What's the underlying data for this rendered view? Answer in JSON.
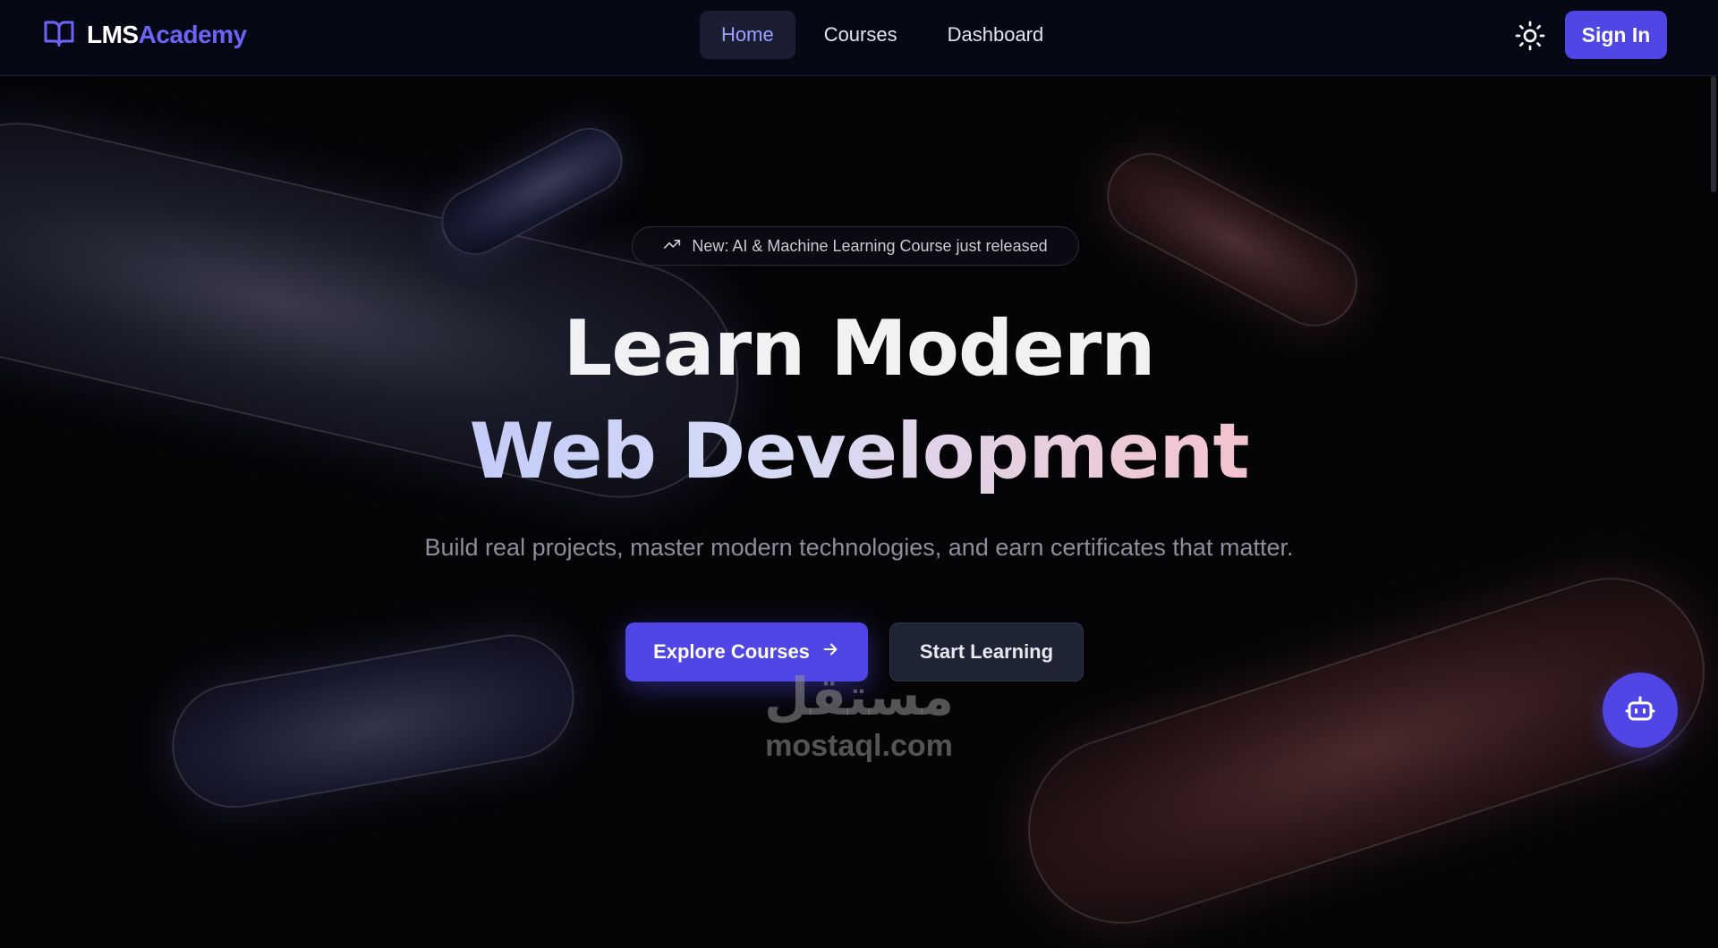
{
  "navbar": {
    "brand_part1": "LMS",
    "brand_part2": "Academy",
    "brand_icon": "book-open-icon",
    "links": [
      {
        "label": "Home",
        "active": true
      },
      {
        "label": "Courses",
        "active": false
      },
      {
        "label": "Dashboard",
        "active": false
      }
    ],
    "theme_icon": "sun-icon",
    "signin_label": "Sign In"
  },
  "hero": {
    "announcement_icon": "trending-up-icon",
    "announcement": "New: AI & Machine Learning Course just released",
    "headline_line1": "Learn Modern",
    "headline_line2": "Web Development",
    "subtitle": "Build real projects, master modern technologies, and earn certificates that matter.",
    "primary_cta": "Explore Courses",
    "primary_cta_icon": "arrow-right-icon",
    "secondary_cta": "Start Learning"
  },
  "watermark": {
    "arabic": "مستقل",
    "latin": "mostaql.com"
  },
  "chatbot": {
    "icon": "bot-icon"
  },
  "colors": {
    "accent": "#4f46e5",
    "brand_highlight": "#6d63f5",
    "background": "#050508",
    "nav_bg": "#070816",
    "active_link": "#9aa0ff"
  }
}
